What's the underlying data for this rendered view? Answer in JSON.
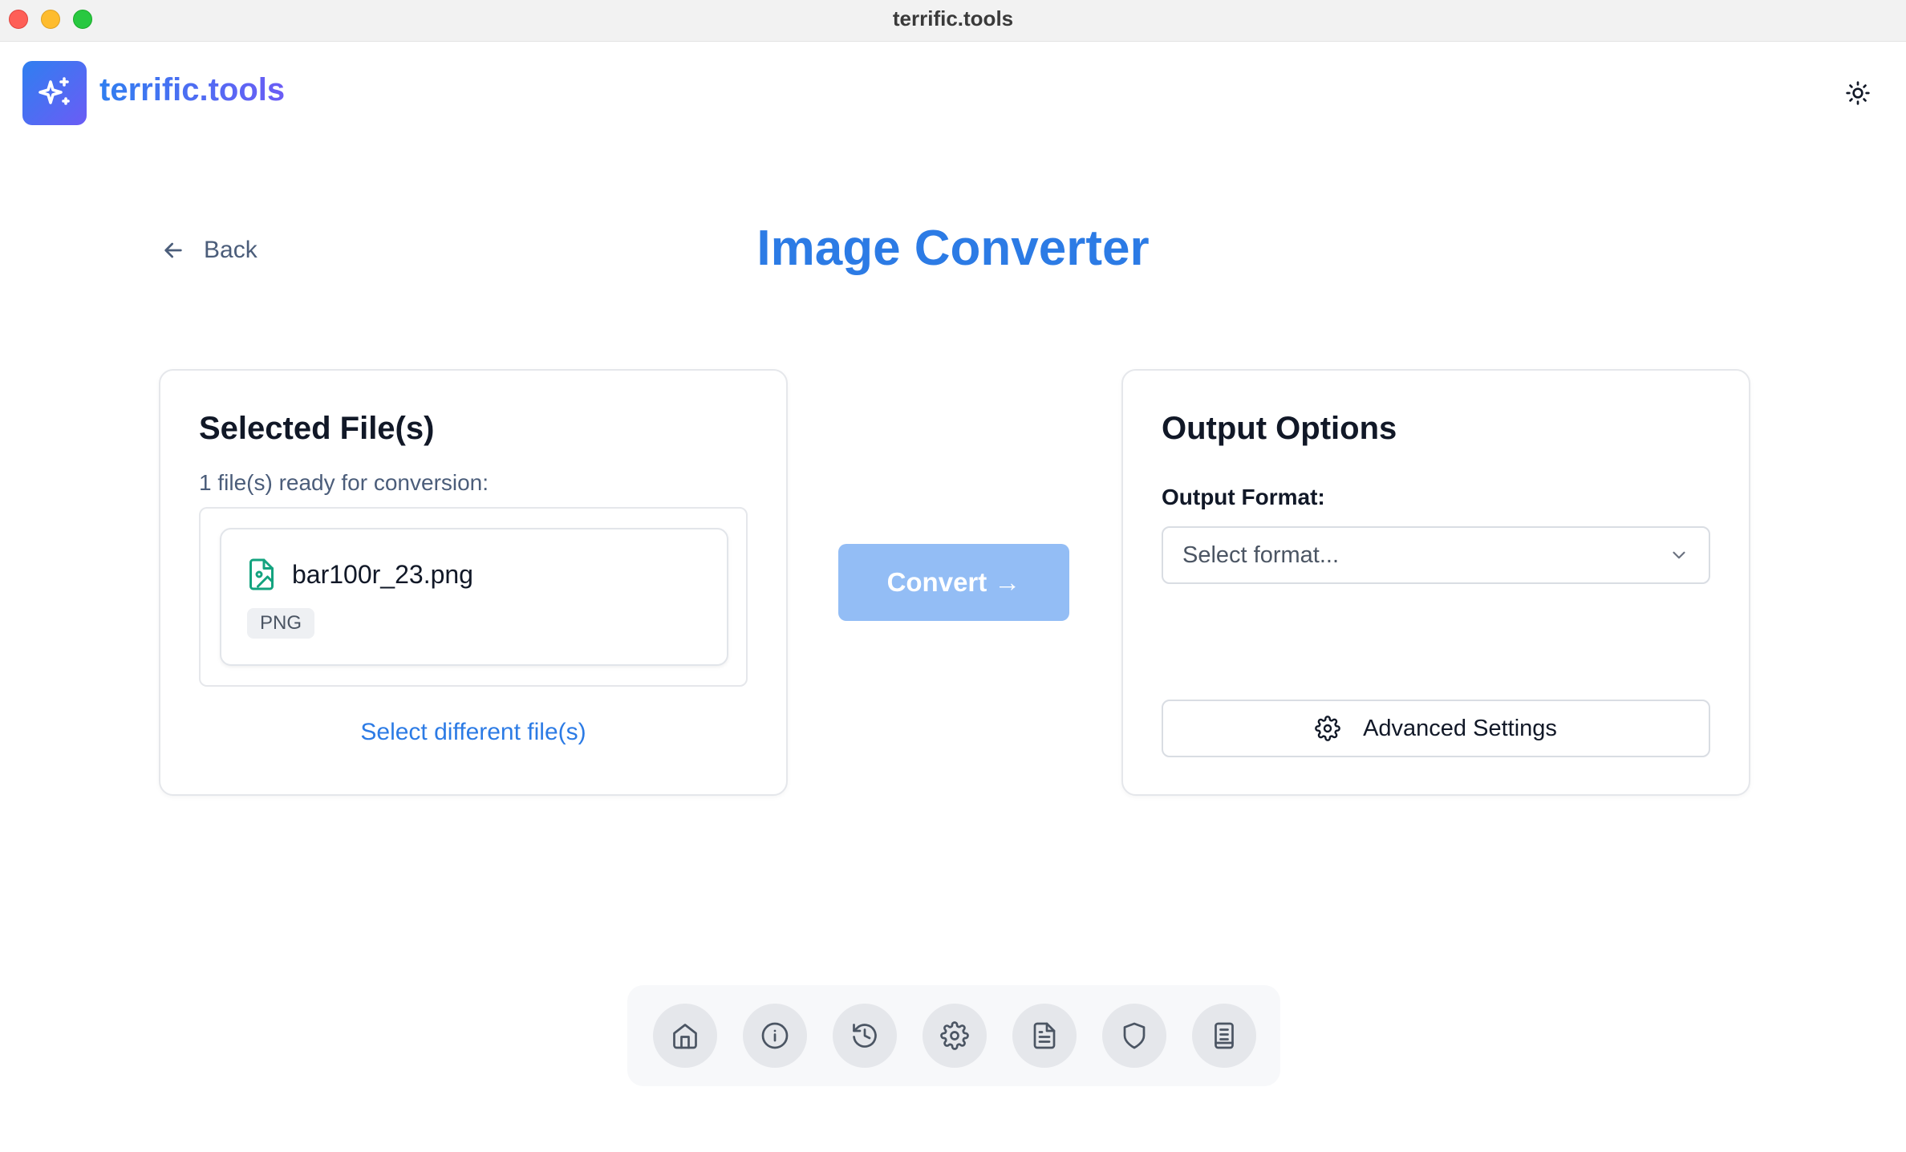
{
  "window": {
    "title": "terrific.tools"
  },
  "header": {
    "brand": "terrific.tools",
    "logo_icon": "sparkles-icon",
    "theme_icon": "sun-icon"
  },
  "nav": {
    "back_label": "Back",
    "back_icon": "arrow-left-icon"
  },
  "page": {
    "title": "Image Converter"
  },
  "selected_files": {
    "title": "Selected File(s)",
    "ready_text": "1 file(s) ready for conversion:",
    "files": [
      {
        "name": "bar100r_23.png",
        "format": "PNG",
        "icon": "image-file-icon"
      }
    ],
    "select_different_label": "Select different file(s)"
  },
  "convert": {
    "label": "Convert →",
    "state": "disabled"
  },
  "output_options": {
    "title": "Output Options",
    "format_label": "Output Format:",
    "format_placeholder": "Select format...",
    "advanced_label": "Advanced Settings"
  },
  "bottom_nav": {
    "items": [
      {
        "icon": "home-icon"
      },
      {
        "icon": "info-icon"
      },
      {
        "icon": "history-icon"
      },
      {
        "icon": "settings-icon"
      },
      {
        "icon": "document-icon"
      },
      {
        "icon": "shield-icon"
      },
      {
        "icon": "book-icon"
      }
    ]
  },
  "colors": {
    "accent": "#2c7be5",
    "accent_purple": "#6b5cf5",
    "convert_disabled": "#93bdf5",
    "file_icon": "#14a37f"
  }
}
